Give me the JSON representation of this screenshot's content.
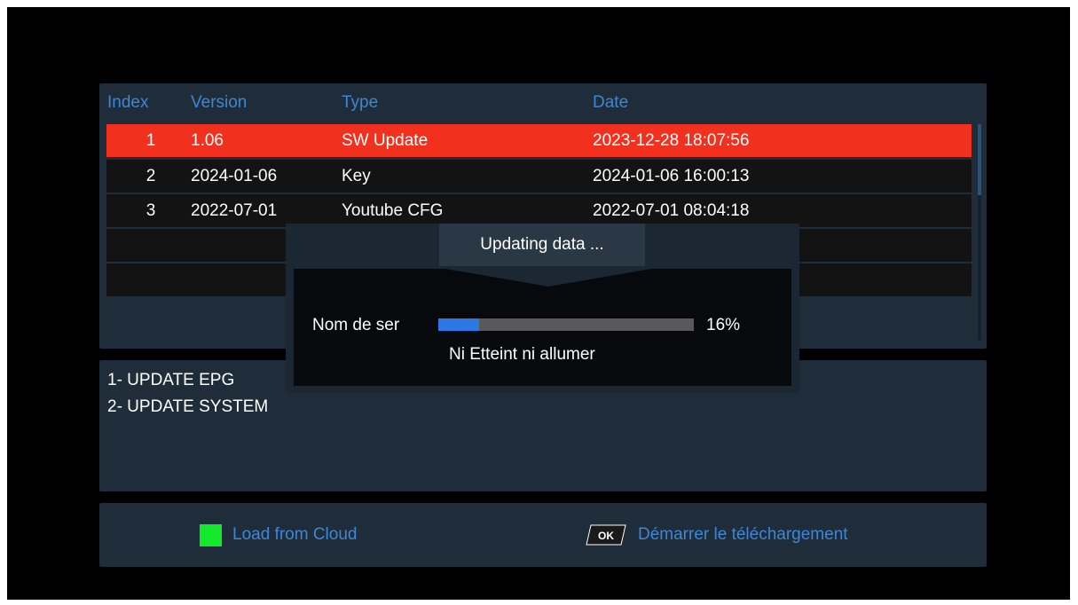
{
  "table": {
    "headers": {
      "index": "Index",
      "version": "Version",
      "type": "Type",
      "date": "Date"
    },
    "rows": [
      {
        "index": "1",
        "version": "1.06",
        "type": "SW Update",
        "date": "2023-12-28 18:07:56"
      },
      {
        "index": "2",
        "version": "2024-01-06",
        "type": "Key",
        "date": "2024-01-06 16:00:13"
      },
      {
        "index": "3",
        "version": "2022-07-01",
        "type": "Youtube CFG",
        "date": "2022-07-01 08:04:18"
      }
    ],
    "selected_index": 0
  },
  "info": {
    "lines": [
      "1- UPDATE EPG",
      "2- UPDATE SYSTEM"
    ]
  },
  "help": {
    "green_label": "Load from Cloud",
    "ok_key": "OK",
    "ok_label": "Démarrer le téléchargement"
  },
  "dialog": {
    "title": "Updating data ...",
    "field_label": "Nom de ser",
    "progress": 16,
    "progress_text": "16%",
    "status": "Ni Etteint ni allumer"
  },
  "colors": {
    "selected_row": "#f1311e",
    "header_text": "#3e86d6",
    "green_key": "#13e82d",
    "progress_fill": "#2b78e4"
  }
}
